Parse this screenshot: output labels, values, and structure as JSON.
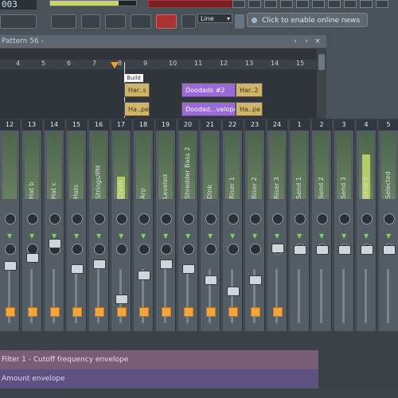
{
  "top": {
    "lcd": "003",
    "news": "Click to enable online news",
    "select_value": "Line"
  },
  "tab": {
    "label": "Pattern 56 -",
    "icons": [
      "chevron-left-icon",
      "chevron-right-icon",
      "close-icon"
    ]
  },
  "ruler": {
    "bars": [
      "4",
      "5",
      "6",
      "7",
      "8",
      "9",
      "10",
      "11",
      "12",
      "13",
      "14",
      "15"
    ],
    "marker_label": "Build"
  },
  "playlist": {
    "clips": [
      {
        "label": "Har..s",
        "color": "gold"
      },
      {
        "label": "Doodads #2",
        "color": "purple"
      },
      {
        "label": "Har..2",
        "color": "gold"
      },
      {
        "label": "Ha..pe",
        "color": "gold"
      },
      {
        "label": "Doodad...velope",
        "color": "purple"
      },
      {
        "label": "Ha..pe",
        "color": "gold"
      }
    ]
  },
  "mixer": {
    "strips": [
      {
        "num": "12",
        "name": ""
      },
      {
        "num": "13",
        "name": "Hat b"
      },
      {
        "num": "14",
        "name": "Hat c"
      },
      {
        "num": "15",
        "name": "Hats"
      },
      {
        "num": "16",
        "name": "Strings/PM"
      },
      {
        "num": "17",
        "name": "Crash"
      },
      {
        "num": "18",
        "name": "Arp"
      },
      {
        "num": "19",
        "name": "Leveled"
      },
      {
        "num": "20",
        "name": "Shredder Bass 2"
      },
      {
        "num": "21",
        "name": "Dink"
      },
      {
        "num": "22",
        "name": "Riser 1"
      },
      {
        "num": "23",
        "name": "Riser 2"
      },
      {
        "num": "24",
        "name": "Riser 3"
      },
      {
        "num": "1",
        "name": "Send 1"
      },
      {
        "num": "2",
        "name": "Send 2"
      },
      {
        "num": "3",
        "name": "Send 3"
      },
      {
        "num": "4",
        "name": "Send 4"
      },
      {
        "num": "5",
        "name": "Selected"
      }
    ]
  },
  "envelopes": {
    "cutoff": "Filter 1 - Cutoff frequency envelope",
    "amount": "Amount envelope"
  }
}
